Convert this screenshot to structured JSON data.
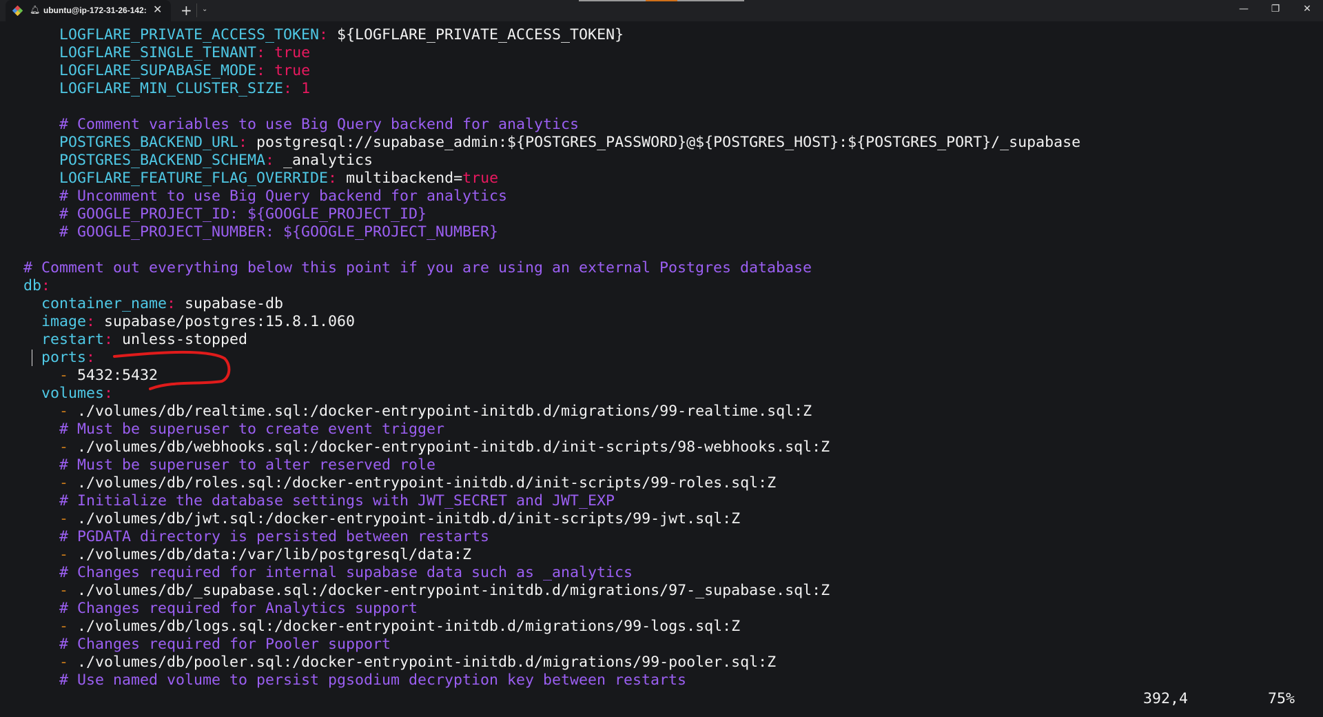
{
  "window": {
    "tab_title": "ubuntu@ip-172-31-26-142:",
    "new_tab": "+",
    "dropdown": "⌄",
    "close_tab": "✕",
    "minimize": "—",
    "maximize": "❐",
    "close": "✕"
  },
  "colors": {
    "key": "#4fc9e6",
    "punct": "#e8185f",
    "comment": "#9b5ff2",
    "value": "#f2f2f2",
    "dash": "#c87a1a",
    "annotation": "#e01b1b"
  },
  "editor": {
    "lines": [
      [
        [
          "    ",
          ""
        ],
        [
          "LOGFLARE_PRIVATE_ACCESS_TOKEN",
          "key"
        ],
        [
          ":",
          "punct"
        ],
        [
          " ${LOGFLARE_PRIVATE_ACCESS_TOKEN}",
          "val"
        ]
      ],
      [
        [
          "    ",
          ""
        ],
        [
          "LOGFLARE_SINGLE_TENANT",
          "key"
        ],
        [
          ":",
          "punct"
        ],
        [
          " ",
          ""
        ],
        [
          "true",
          "bool"
        ]
      ],
      [
        [
          "    ",
          ""
        ],
        [
          "LOGFLARE_SUPABASE_MODE",
          "key"
        ],
        [
          ":",
          "punct"
        ],
        [
          " ",
          ""
        ],
        [
          "true",
          "bool"
        ]
      ],
      [
        [
          "    ",
          ""
        ],
        [
          "LOGFLARE_MIN_CLUSTER_SIZE",
          "key"
        ],
        [
          ":",
          "punct"
        ],
        [
          " ",
          ""
        ],
        [
          "1",
          "bool"
        ]
      ],
      [],
      [
        [
          "    ",
          ""
        ],
        [
          "# Comment variables to use Big Query backend for analytics",
          "comment"
        ]
      ],
      [
        [
          "    ",
          ""
        ],
        [
          "POSTGRES_BACKEND_URL",
          "key"
        ],
        [
          ":",
          "punct"
        ],
        [
          " postgresql://supabase_admin:${POSTGRES_PASSWORD}@${POSTGRES_HOST}:${POSTGRES_PORT}/_supabase",
          "val"
        ]
      ],
      [
        [
          "    ",
          ""
        ],
        [
          "POSTGRES_BACKEND_SCHEMA",
          "key"
        ],
        [
          ":",
          "punct"
        ],
        [
          " _analytics",
          "val"
        ]
      ],
      [
        [
          "    ",
          ""
        ],
        [
          "LOGFLARE_FEATURE_FLAG_OVERRIDE",
          "key"
        ],
        [
          ":",
          "punct"
        ],
        [
          " multibackend=",
          "val"
        ],
        [
          "true",
          "bool"
        ]
      ],
      [
        [
          "    ",
          ""
        ],
        [
          "# Uncomment to use Big Query backend for analytics",
          "comment"
        ]
      ],
      [
        [
          "    ",
          ""
        ],
        [
          "# GOOGLE_PROJECT_ID: ${GOOGLE_PROJECT_ID}",
          "comment"
        ]
      ],
      [
        [
          "    ",
          ""
        ],
        [
          "# GOOGLE_PROJECT_NUMBER: ${GOOGLE_PROJECT_NUMBER}",
          "comment"
        ]
      ],
      [],
      [
        [
          "# Comment out everything below this point if you are using an external Postgres database",
          "comment"
        ]
      ],
      [
        [
          "db",
          "key"
        ],
        [
          ":",
          "punct"
        ]
      ],
      [
        [
          "  ",
          ""
        ],
        [
          "container_name",
          "key"
        ],
        [
          ":",
          "punct"
        ],
        [
          " supabase-db",
          "val"
        ]
      ],
      [
        [
          "  ",
          ""
        ],
        [
          "image",
          "key"
        ],
        [
          ":",
          "punct"
        ],
        [
          " supabase/postgres:15.8.1.060",
          "val"
        ]
      ],
      [
        [
          "  ",
          ""
        ],
        [
          "restart",
          "key"
        ],
        [
          ":",
          "punct"
        ],
        [
          " unless-stopped",
          "val"
        ]
      ],
      [
        [
          "  ",
          ""
        ],
        [
          "ports",
          "key"
        ],
        [
          ":",
          "punct"
        ]
      ],
      [
        [
          "    ",
          ""
        ],
        [
          "-",
          "dash"
        ],
        [
          " 5432:5432",
          "val"
        ]
      ],
      [
        [
          "  ",
          ""
        ],
        [
          "volumes",
          "key"
        ],
        [
          ":",
          "punct"
        ]
      ],
      [
        [
          "    ",
          ""
        ],
        [
          "-",
          "dash"
        ],
        [
          " ./volumes/db/realtime.sql:/docker-entrypoint-initdb.d/migrations/99-realtime.sql:Z",
          "val"
        ]
      ],
      [
        [
          "    ",
          ""
        ],
        [
          "# Must be superuser to create event trigger",
          "comment"
        ]
      ],
      [
        [
          "    ",
          ""
        ],
        [
          "-",
          "dash"
        ],
        [
          " ./volumes/db/webhooks.sql:/docker-entrypoint-initdb.d/init-scripts/98-webhooks.sql:Z",
          "val"
        ]
      ],
      [
        [
          "    ",
          ""
        ],
        [
          "# Must be superuser to alter reserved role",
          "comment"
        ]
      ],
      [
        [
          "    ",
          ""
        ],
        [
          "-",
          "dash"
        ],
        [
          " ./volumes/db/roles.sql:/docker-entrypoint-initdb.d/init-scripts/99-roles.sql:Z",
          "val"
        ]
      ],
      [
        [
          "    ",
          ""
        ],
        [
          "# Initialize the database settings with JWT_SECRET and JWT_EXP",
          "comment"
        ]
      ],
      [
        [
          "    ",
          ""
        ],
        [
          "-",
          "dash"
        ],
        [
          " ./volumes/db/jwt.sql:/docker-entrypoint-initdb.d/init-scripts/99-jwt.sql:Z",
          "val"
        ]
      ],
      [
        [
          "    ",
          ""
        ],
        [
          "# PGDATA directory is persisted between restarts",
          "comment"
        ]
      ],
      [
        [
          "    ",
          ""
        ],
        [
          "-",
          "dash"
        ],
        [
          " ./volumes/db/data:/var/lib/postgresql/data:Z",
          "val"
        ]
      ],
      [
        [
          "    ",
          ""
        ],
        [
          "# Changes required for internal supabase data such as _analytics",
          "comment"
        ]
      ],
      [
        [
          "    ",
          ""
        ],
        [
          "-",
          "dash"
        ],
        [
          " ./volumes/db/_supabase.sql:/docker-entrypoint-initdb.d/migrations/97-_supabase.sql:Z",
          "val"
        ]
      ],
      [
        [
          "    ",
          ""
        ],
        [
          "# Changes required for Analytics support",
          "comment"
        ]
      ],
      [
        [
          "    ",
          ""
        ],
        [
          "-",
          "dash"
        ],
        [
          " ./volumes/db/logs.sql:/docker-entrypoint-initdb.d/migrations/99-logs.sql:Z",
          "val"
        ]
      ],
      [
        [
          "    ",
          ""
        ],
        [
          "# Changes required for Pooler support",
          "comment"
        ]
      ],
      [
        [
          "    ",
          ""
        ],
        [
          "-",
          "dash"
        ],
        [
          " ./volumes/db/pooler.sql:/docker-entrypoint-initdb.d/migrations/99-pooler.sql:Z",
          "val"
        ]
      ],
      [
        [
          "    ",
          ""
        ],
        [
          "# Use named volume to persist pgsodium decryption key between restarts",
          "comment"
        ]
      ]
    ]
  },
  "status": {
    "position": "392,4",
    "scroll_percent": "75%"
  }
}
